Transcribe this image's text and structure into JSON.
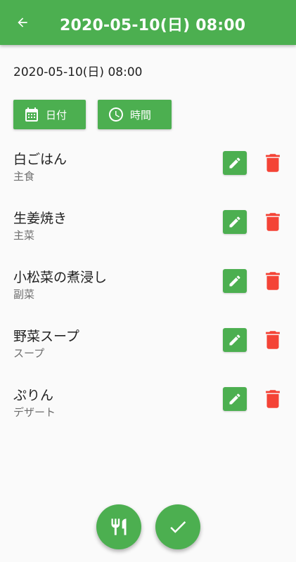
{
  "app_bar": {
    "title": "2020-05-10(日) 08:00",
    "back_icon": "arrow-back-icon",
    "color": "#4caf50"
  },
  "datetime_display": "2020-05-10(日) 08:00",
  "buttons": {
    "date_label": "日付",
    "time_label": "時間"
  },
  "items": [
    {
      "name": "白ごはん",
      "category": "主食"
    },
    {
      "name": "生姜焼き",
      "category": "主菜"
    },
    {
      "name": "小松菜の煮浸し",
      "category": "副菜"
    },
    {
      "name": "野菜スープ",
      "category": "スープ"
    },
    {
      "name": "ぷりん",
      "category": "デザート"
    }
  ],
  "icons": {
    "edit": "pencil-icon",
    "delete": "trash-icon",
    "meal": "utensils-icon",
    "confirm": "check-icon"
  },
  "colors": {
    "primary": "#4caf50",
    "delete": "#f44336"
  }
}
